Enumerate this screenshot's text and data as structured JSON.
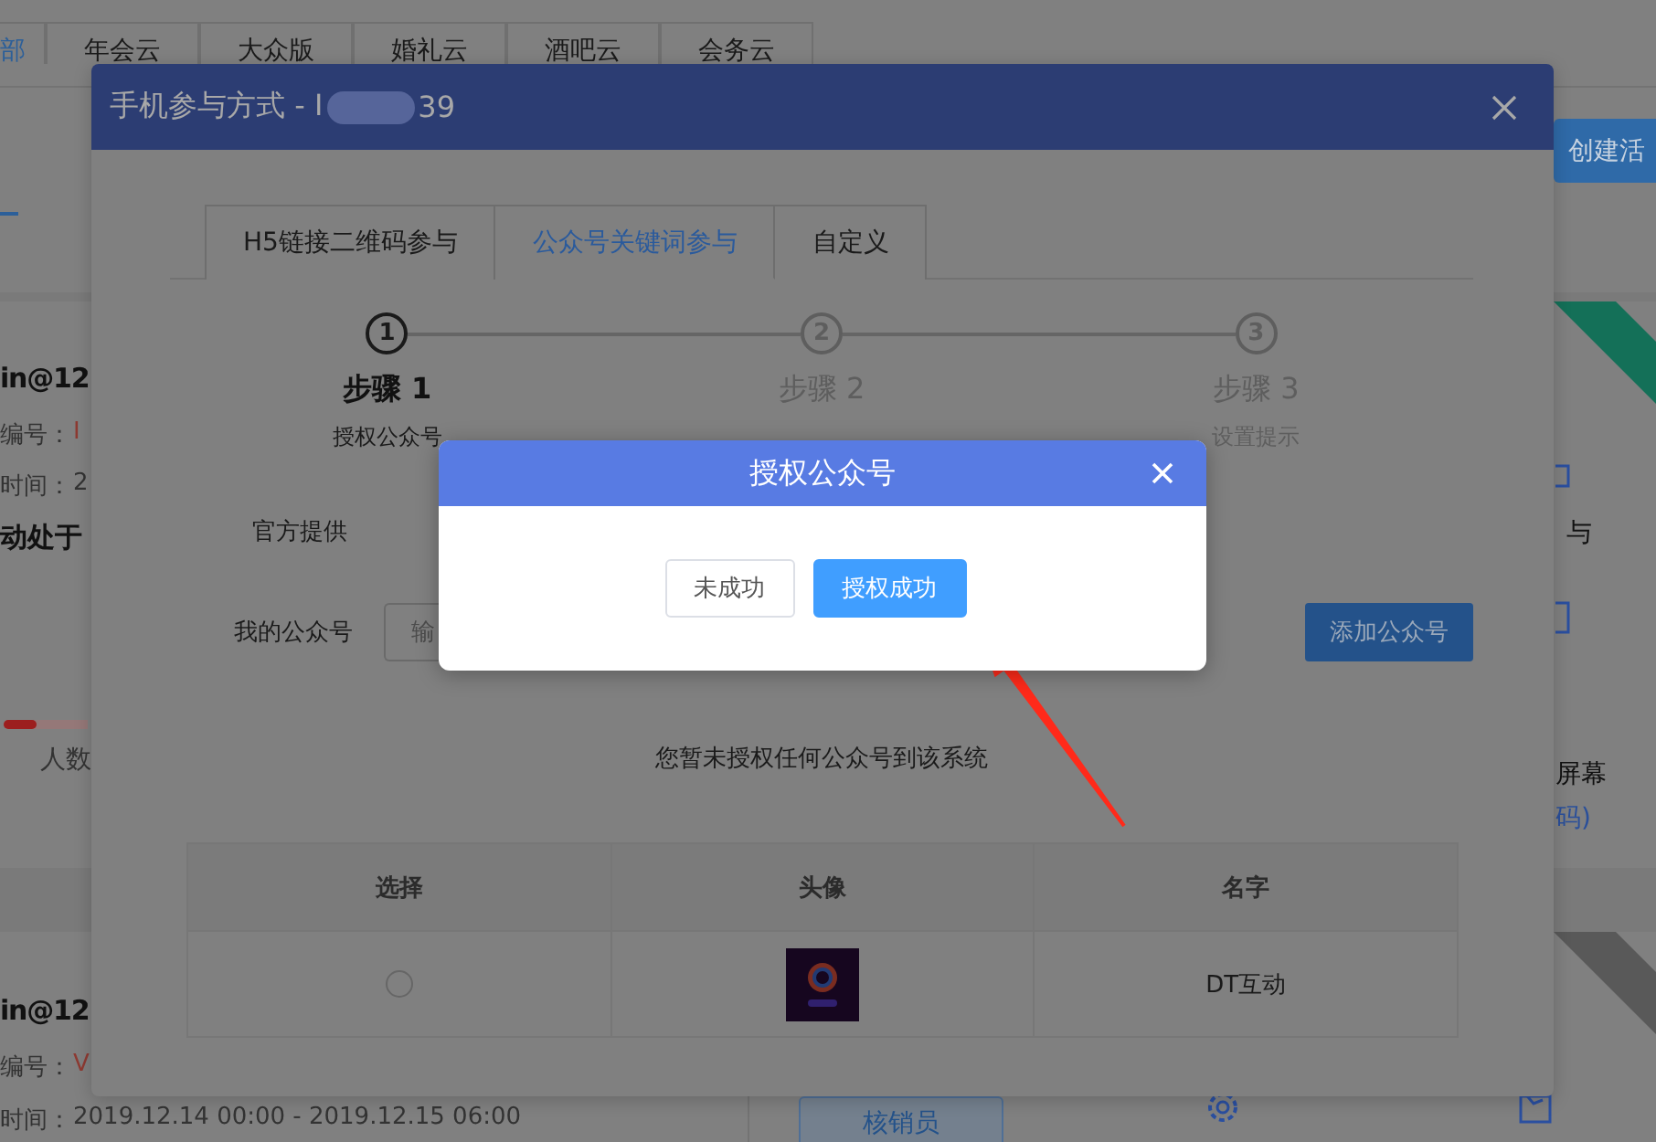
{
  "background": {
    "tabs": [
      {
        "label": "部",
        "selected": true
      },
      {
        "label": "年会云",
        "selected": false
      },
      {
        "label": "大众版",
        "selected": false
      },
      {
        "label": "婚礼云",
        "selected": false
      },
      {
        "label": "酒吧云",
        "selected": false
      },
      {
        "label": "会务云",
        "selected": false
      }
    ],
    "create_button": "创建活",
    "cards": [
      {
        "account": "in@12",
        "number_label": "编号：",
        "number": "I",
        "time_label": "时间：",
        "time": "2",
        "status": "动处于",
        "progress": {
          "level": 0.4
        },
        "count_label": "人数",
        "ribbon": {
          "color": "#147058"
        },
        "features": [
          {
            "label": "与",
            "kind": "plain"
          },
          {
            "label": "屏幕",
            "kind": "plain"
          },
          {
            "label": "码)",
            "kind": "link"
          }
        ]
      },
      {
        "account": "in@12",
        "number_label": "编号：",
        "number": "V",
        "time_label": "时间：",
        "time": "2019.12.14 00:00 - 2019.12.15 06:00",
        "ribbon": {
          "color": "#595959"
        },
        "button": "核销员"
      }
    ]
  },
  "dialog": {
    "title": "手机参与方式 - I",
    "title_tail": "39",
    "tabs": [
      {
        "label": "H5链接二维码参与",
        "selected": false
      },
      {
        "label": "公众号关键词参与",
        "selected": true
      },
      {
        "label": "自定义",
        "selected": false
      }
    ],
    "steps": [
      {
        "number": "1",
        "title": "步骤 1",
        "caption": "授权公众号",
        "active": true
      },
      {
        "number": "2",
        "title": "步骤 2",
        "active": false
      },
      {
        "number": "3",
        "title": "步骤 3",
        "caption": "设置提示",
        "active": false
      }
    ],
    "official_label": "官方提供",
    "account_label": "我的公众号",
    "account_field": {
      "placeholder": "输"
    },
    "add_button": "添加公众号",
    "empty_message": "您暂未授权任何公众号到该系统",
    "table": {
      "columns": [
        "选择",
        "头像",
        "名字"
      ],
      "rows": [
        {
          "selected": false,
          "name": "DT互动"
        }
      ]
    }
  },
  "modal": {
    "title": "授权公众号",
    "buttons": [
      {
        "label": "未成功",
        "kind": "secondary"
      },
      {
        "label": "授权成功",
        "kind": "primary"
      }
    ]
  }
}
